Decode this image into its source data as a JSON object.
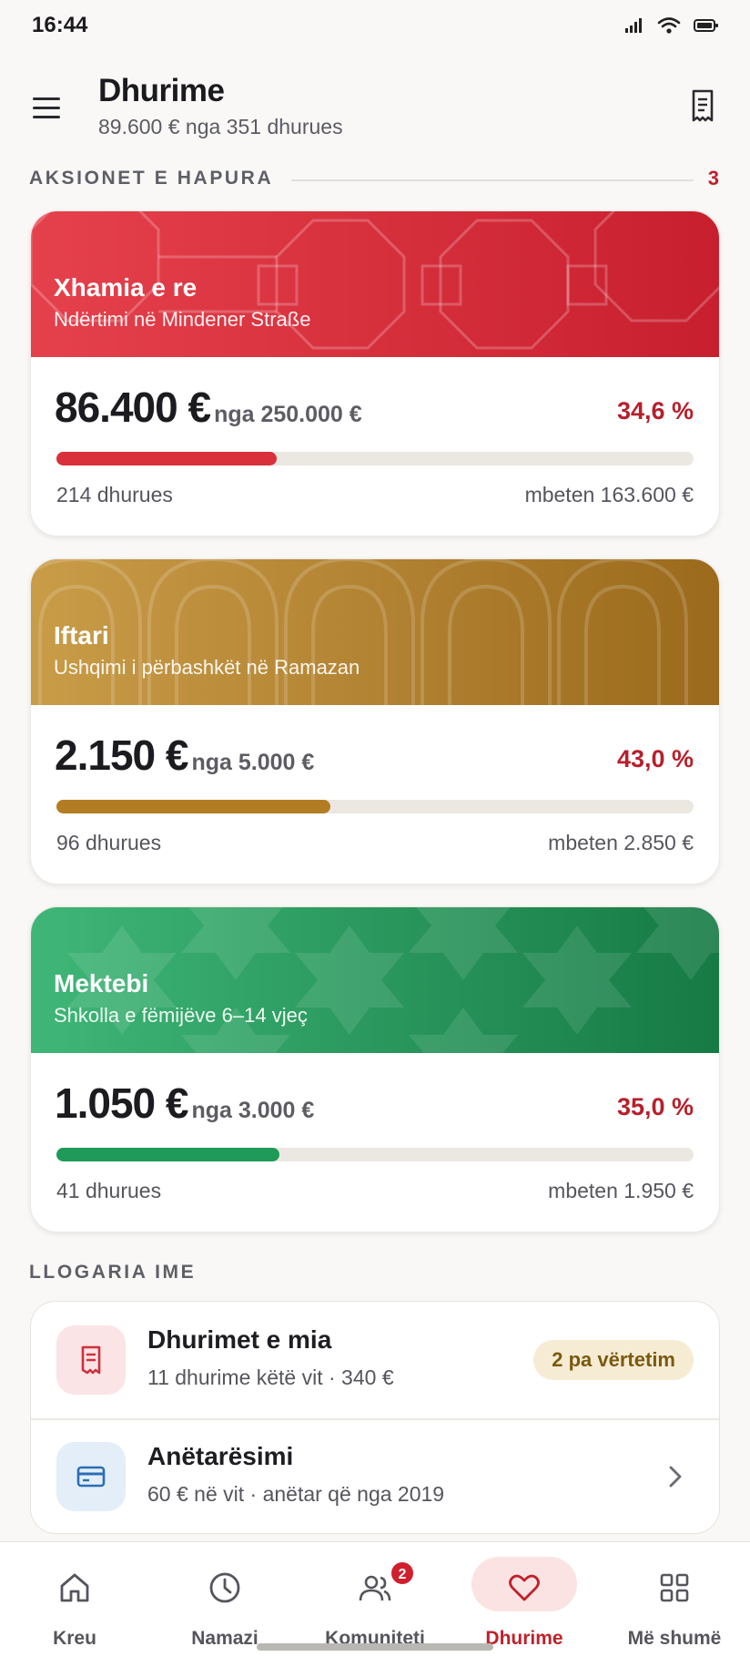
{
  "status_bar": {
    "time": "16:44"
  },
  "header": {
    "title": "Dhurime",
    "subtitle": "89.600 € nga 351 dhurues"
  },
  "open_campaigns": {
    "heading": "AKSIONET E HAPURA",
    "count": "3",
    "items": [
      {
        "title": "Xhamia e re",
        "subtitle": "Ndërtimi në Mindener Straße",
        "raised": "86.400 €",
        "goal": "nga 250.000 €",
        "percent_label": "34,6 %",
        "progress": 0.346,
        "donors": "214 dhurues",
        "remaining": "mbeten 163.600 €",
        "color": "#d9303c"
      },
      {
        "title": "Iftari",
        "subtitle": "Ushqimi i përbashkët në Ramazan",
        "raised": "2.150 €",
        "goal": "nga 5.000 €",
        "percent_label": "43,0 %",
        "progress": 0.43,
        "donors": "96 dhurues",
        "remaining": "mbeten 2.850 €",
        "color": "#b27d22"
      },
      {
        "title": "Mektebi",
        "subtitle": "Shkolla e fëmijëve 6–14 vjeç",
        "raised": "1.050 €",
        "goal": "nga 3.000 €",
        "percent_label": "35,0 %",
        "progress": 0.35,
        "donors": "41 dhurues",
        "remaining": "mbeten 1.950 €",
        "color": "#1f9a58"
      }
    ]
  },
  "account": {
    "heading": "LLOGARIA IME",
    "donations": {
      "title": "Dhurimet e mia",
      "subtitle": "11 dhurime këtë vit · 340 €",
      "badge": "2 pa vërtetim"
    },
    "membership": {
      "title": "Anëtarësimi",
      "subtitle": "60 € në vit · anëtar që nga 2019"
    }
  },
  "bottom_nav": {
    "items": [
      {
        "label": "Kreu",
        "icon": "home-icon"
      },
      {
        "label": "Namazi",
        "icon": "clock-icon"
      },
      {
        "label": "Komuniteti",
        "icon": "people-icon",
        "badge": "2"
      },
      {
        "label": "Dhurime",
        "icon": "heart-icon",
        "active": true
      },
      {
        "label": "Më shumë",
        "icon": "grid-icon"
      }
    ]
  }
}
